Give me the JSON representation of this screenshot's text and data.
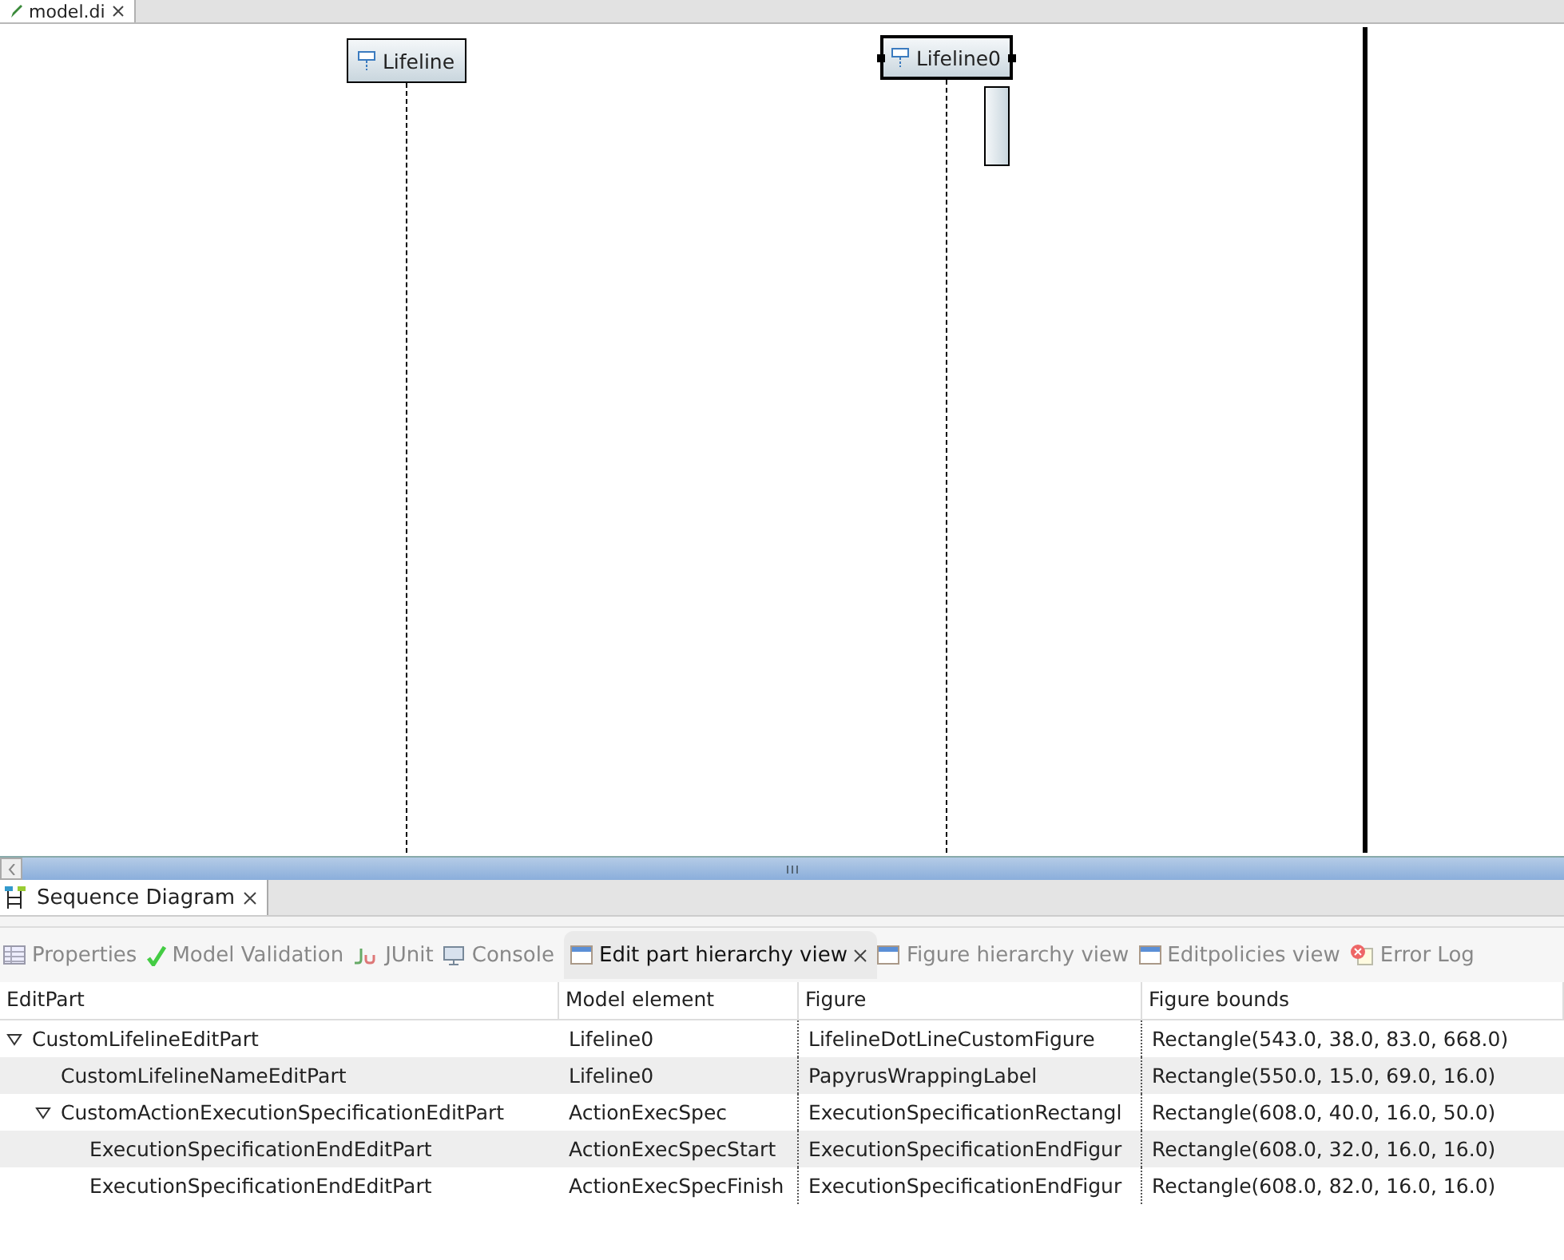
{
  "editor_tab": {
    "title": "model.di"
  },
  "diagram": {
    "lifelines": [
      {
        "name": "Lifeline",
        "selected": false,
        "execution": false
      },
      {
        "name": "Lifeline0",
        "selected": true,
        "execution": true
      }
    ]
  },
  "panel_tab": {
    "title": "Sequence Diagram"
  },
  "view_tabs": [
    {
      "label": "Properties",
      "kind": "table",
      "selected": false
    },
    {
      "label": "Model Validation",
      "kind": "check",
      "selected": false
    },
    {
      "label": "JUnit",
      "kind": "junit",
      "selected": false
    },
    {
      "label": "Console",
      "kind": "console",
      "selected": false
    },
    {
      "label": "Edit part hierarchy view",
      "kind": "window",
      "selected": true
    },
    {
      "label": "Figure hierarchy view",
      "kind": "window",
      "selected": false
    },
    {
      "label": "Editpolicies view",
      "kind": "window",
      "selected": false
    },
    {
      "label": "Error Log",
      "kind": "error",
      "selected": false
    }
  ],
  "table": {
    "columns": [
      "EditPart",
      "Model element",
      "Figure",
      "Figure bounds"
    ],
    "rows": [
      {
        "cells": [
          "CustomLifelineEditPart",
          "Lifeline0",
          "LifelineDotLineCustomFigure",
          "Rectangle(543.0, 38.0, 83.0, 668.0)"
        ],
        "expanded": true,
        "children": [
          {
            "cells": [
              "CustomLifelineNameEditPart",
              "Lifeline0",
              "PapyrusWrappingLabel",
              "Rectangle(550.0, 15.0, 69.0, 16.0)"
            ]
          },
          {
            "cells": [
              "CustomActionExecutionSpecificationEditPart",
              "ActionExecSpec",
              "ExecutionSpecificationRectangl",
              "Rectangle(608.0, 40.0, 16.0, 50.0)"
            ],
            "expanded": true,
            "children": [
              {
                "cells": [
                  "ExecutionSpecificationEndEditPart",
                  "ActionExecSpecStart",
                  "ExecutionSpecificationEndFigur",
                  "Rectangle(608.0, 32.0, 16.0, 16.0)"
                ]
              },
              {
                "cells": [
                  "ExecutionSpecificationEndEditPart",
                  "ActionExecSpecFinish",
                  "ExecutionSpecificationEndFigur",
                  "Rectangle(608.0, 82.0, 16.0, 16.0)"
                ]
              }
            ]
          }
        ]
      }
    ]
  }
}
